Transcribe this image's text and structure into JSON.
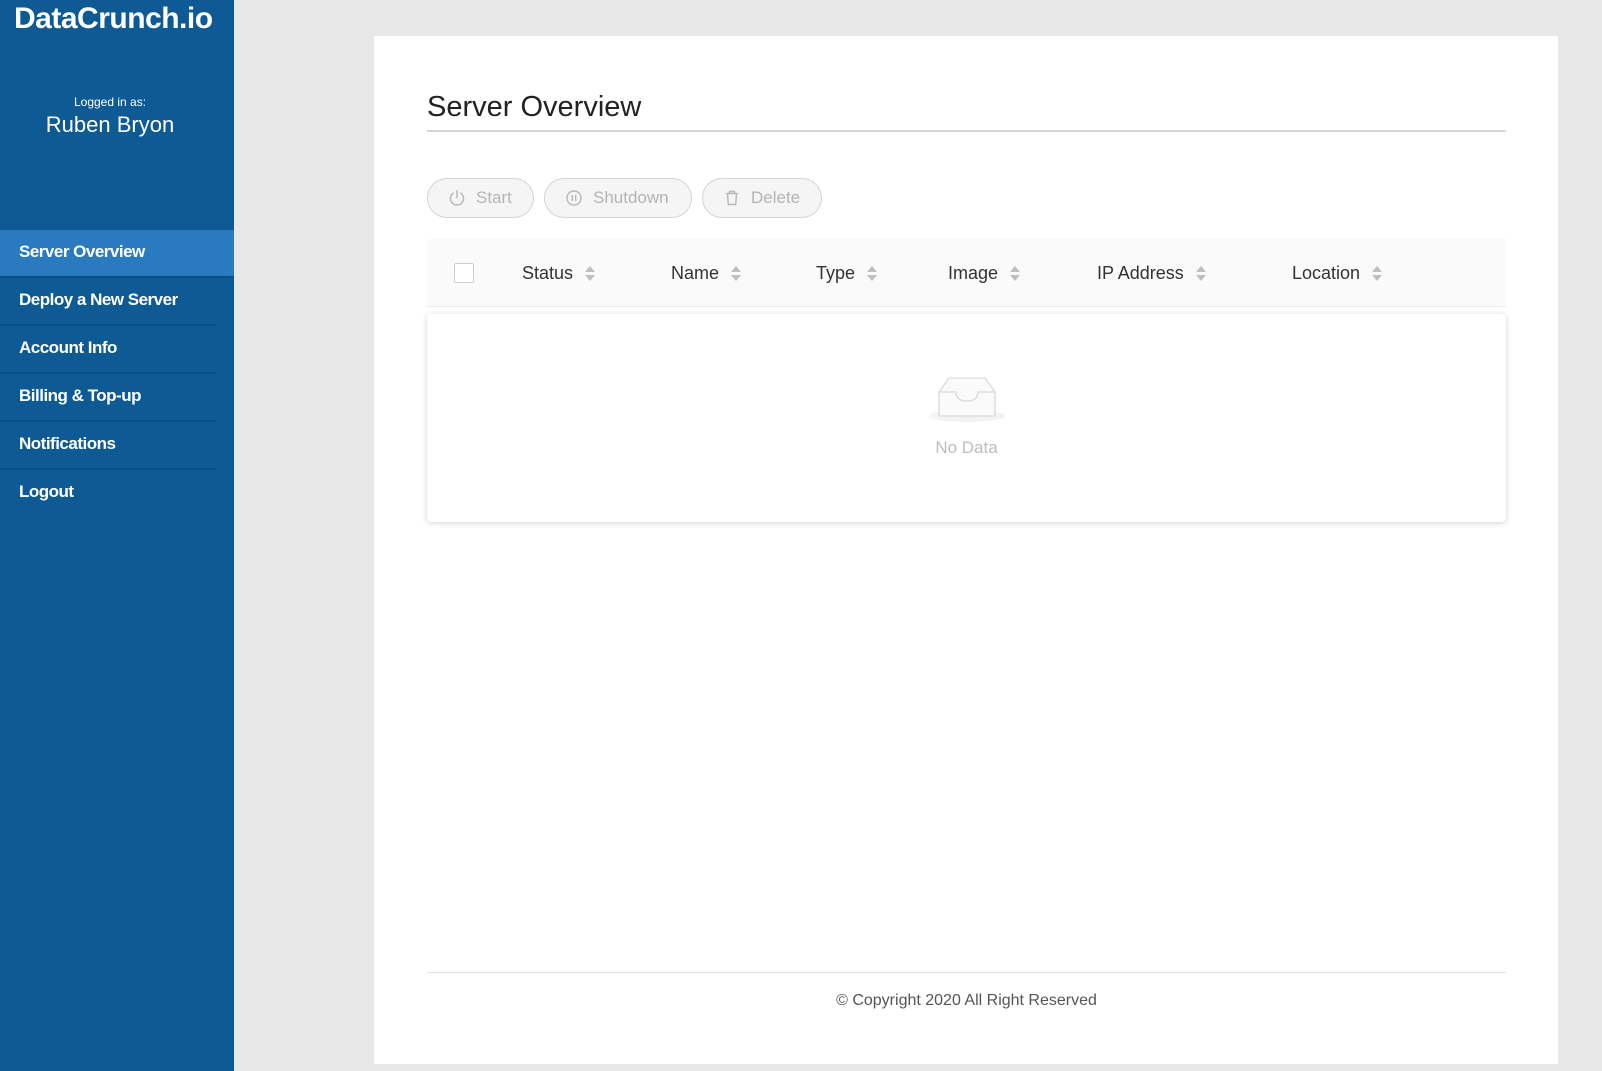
{
  "sidebar": {
    "brand": "DataCrunch.io",
    "logged_in_caption": "Logged in as:",
    "user_name": "Ruben Bryon",
    "items": [
      {
        "label": "Server Overview",
        "active": true
      },
      {
        "label": "Deploy a New Server"
      },
      {
        "label": "Account Info"
      },
      {
        "label": "Billing & Top-up"
      },
      {
        "label": "Notifications"
      },
      {
        "label": "Logout"
      }
    ]
  },
  "main": {
    "title": "Server Overview",
    "toolbar": {
      "start_label": "Start",
      "shutdown_label": "Shutdown",
      "delete_label": "Delete",
      "start_icon": "power-icon",
      "shutdown_icon": "pause-circle-icon",
      "delete_icon": "trash-icon"
    },
    "table": {
      "columns": [
        "Status",
        "Name",
        "Type",
        "Image",
        "IP Address",
        "Location"
      ],
      "rows": [],
      "empty_text": "No Data",
      "empty_icon": "inbox-icon"
    },
    "footer": "© Copyright 2020 All Right Reserved"
  },
  "colors": {
    "sidebar_bg": "#0e5a94",
    "sidebar_active": "#2a7ac0",
    "page_bg": "#e8e8e8",
    "panel_bg": "#ffffff"
  }
}
